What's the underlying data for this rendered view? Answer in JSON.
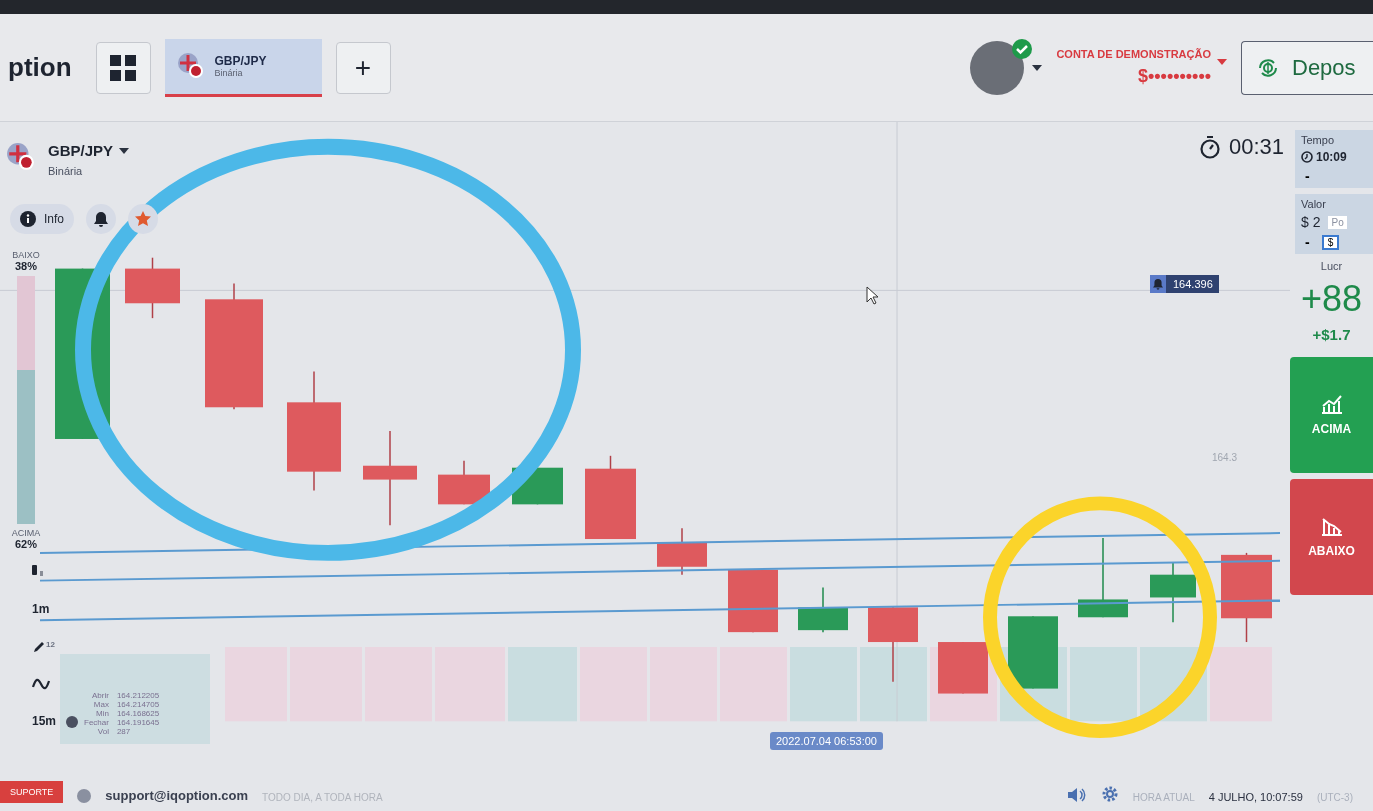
{
  "header": {
    "logo": "ption",
    "tabs": [
      {
        "pair": "GBP/JPY",
        "type": "Binária",
        "selected": true
      }
    ],
    "add_label": "+"
  },
  "account": {
    "label": "CONTA DE DEMONSTRAÇÃO",
    "balance": "$••••••••••",
    "verified": true
  },
  "deposit": "Depos",
  "asset": {
    "pair": "GBP/JPY",
    "type": "Binária",
    "info": "Info"
  },
  "timer": "00:31",
  "sentiment": {
    "down_label": "BAIXO",
    "down_pct": "38%",
    "up_label": "ACIMA",
    "up_pct": "62%",
    "level": 0.62
  },
  "tools": [
    {
      "kind": "candles"
    },
    {
      "kind": "text",
      "label": "1m"
    },
    {
      "kind": "draw",
      "count": "12"
    },
    {
      "kind": "indicator"
    },
    {
      "kind": "text",
      "label": "15m"
    }
  ],
  "ohlc": [
    {
      "label": "Abrir",
      "value": "164.212205"
    },
    {
      "label": "Max",
      "value": "164.214705"
    },
    {
      "label": "Min",
      "value": "164.168625"
    },
    {
      "label": "Fechar",
      "value": "164.191645"
    },
    {
      "label": "Vol",
      "value": "287"
    }
  ],
  "chart": {
    "price_tag": "164.396",
    "axis_label": "164.3",
    "time_tag": "2022.07.04 06:53:00"
  },
  "right_panel": {
    "time_label": "Tempo",
    "time": "10:09",
    "time_minus": "-",
    "amount_label": "Valor",
    "amount": "$ 2",
    "amount_hint": "Po",
    "amount_minus": "-",
    "amount_unit": "$",
    "profit_label": "Lucr",
    "profit_pct": "+88",
    "profit_value": "+$1.7",
    "call": "ACIMA",
    "put": "ABAIXO"
  },
  "footer": {
    "support_button": "SUPORTE",
    "email": "support@iqoption.com",
    "hours": "TODO DIA, A TODA HORA",
    "clock_label": "HORA ATUAL",
    "clock": "4 JULHO, 10:07:59",
    "timezone": "(UTC-3)"
  }
}
